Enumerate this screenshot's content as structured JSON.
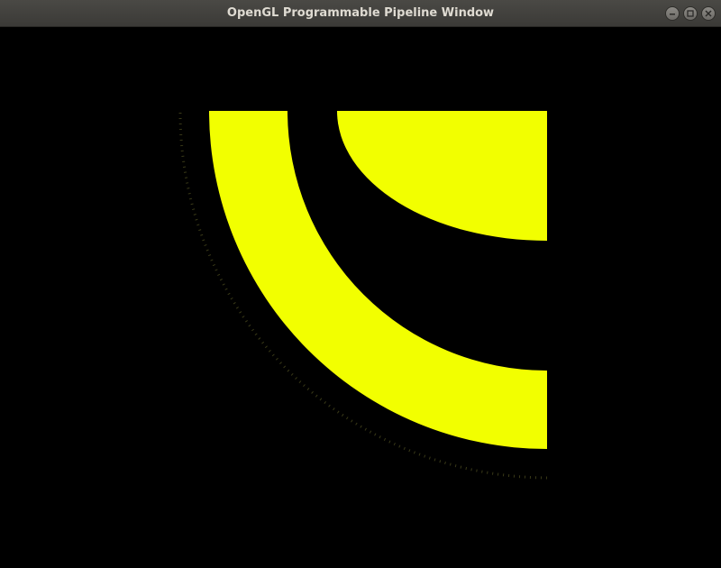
{
  "window": {
    "title": "OpenGL Programmable Pipeline Window"
  },
  "controls": {
    "minimize_icon": "minimize-icon",
    "maximize_icon": "maximize-icon",
    "close_icon": "close-icon"
  },
  "colors": {
    "titlebar": "#3c3b37",
    "background": "#000000",
    "shape_fill": "#f2ff00"
  }
}
